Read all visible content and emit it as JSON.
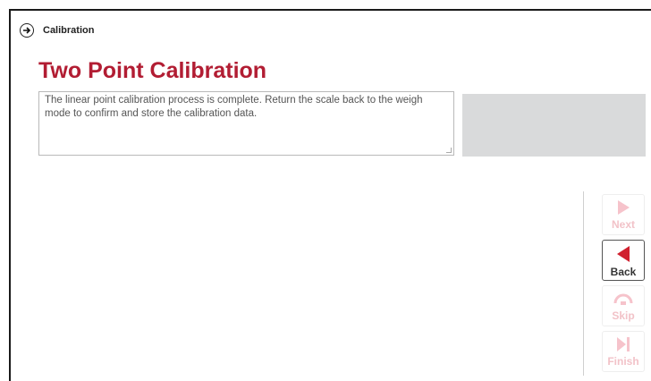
{
  "breadcrumb": {
    "label": "Calibration",
    "icon": "arrow-right-icon"
  },
  "page": {
    "title": "Two Point Calibration",
    "title_color": "#b21d33"
  },
  "message": {
    "text": "The linear point calibration process is complete. Return the scale back to the weigh mode to confirm and store the calibration data."
  },
  "nav": {
    "next": {
      "label": "Next",
      "icon": "play-right-icon",
      "enabled": false
    },
    "back": {
      "label": "Back",
      "icon": "play-left-icon",
      "enabled": true
    },
    "skip": {
      "label": "Skip",
      "icon": "skip-icon",
      "enabled": false
    },
    "finish": {
      "label": "Finish",
      "icon": "finish-icon",
      "enabled": false
    }
  },
  "colors": {
    "accent": "#d0202e",
    "disabled": "#f2c2c8",
    "panel": "#d9dadb"
  }
}
